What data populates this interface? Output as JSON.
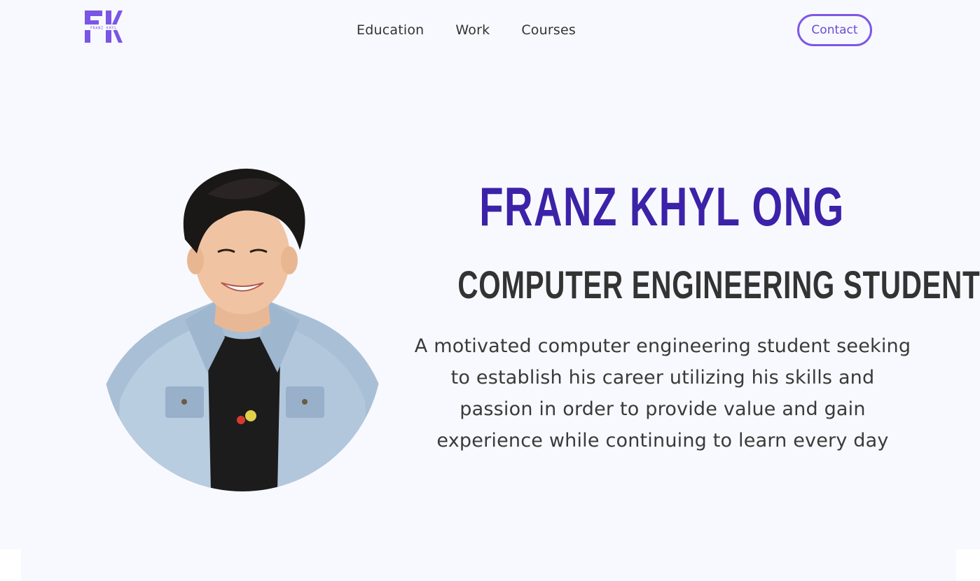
{
  "nav": {
    "logo_text": "FRANZ KHYL",
    "links": [
      {
        "label": "Education"
      },
      {
        "label": "Work"
      },
      {
        "label": "Courses"
      }
    ],
    "contact_label": "Contact"
  },
  "hero": {
    "name": "FRANZ KHYL ONG",
    "role": "COMPUTER ENGINEERING STUDENT",
    "bio": "A motivated computer engineering student seeking to establish his career utilizing his skills and passion in order to provide value and gain experience while continuing to learn every day"
  },
  "colors": {
    "brand": "#3c22a8",
    "accent": "#7e57e6",
    "background": "#f8f9fe",
    "text": "#333333"
  },
  "icons": {
    "logo": "fk-monogram-logo",
    "avatar": "profile-photo"
  }
}
